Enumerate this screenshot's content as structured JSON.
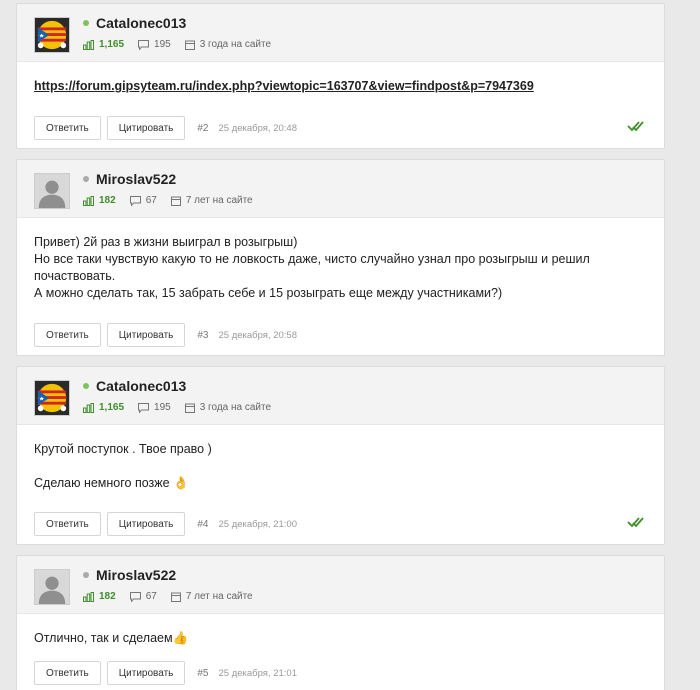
{
  "posts": [
    {
      "username": "Catalonec013",
      "reputation": "1,165",
      "posts_count": "195",
      "on_site": "3 года на сайте",
      "online": true,
      "avatar": "catalonia-flag-icon",
      "body_link": "https://forum.gipsyteam.ru/index.php?viewtopic=163707&view=findpost&p=7947369",
      "reply_label": "Ответить",
      "quote_label": "Цитировать",
      "number": "#2",
      "date": "25 декабря, 20:48",
      "checked": true
    },
    {
      "username": "Miroslav522",
      "reputation": "182",
      "posts_count": "67",
      "on_site": "7 лет на сайте",
      "online": false,
      "avatar": "default-user-avatar",
      "body_lines": [
        "Привет) 2й раз в жизни выиграл в розыгрыш)",
        "Но все таки чувствую какую то не ловкость даже, чисто случайно узнал про розыгрыш и решил почаствовать.",
        "А можно сделать так, 15 забрать себе и 15 розыграть еще между участниками?)"
      ],
      "reply_label": "Ответить",
      "quote_label": "Цитировать",
      "number": "#3",
      "date": "25 декабря, 20:58",
      "checked": false
    },
    {
      "username": "Catalonec013",
      "reputation": "1,165",
      "posts_count": "195",
      "on_site": "3 года на сайте",
      "online": true,
      "avatar": "catalonia-flag-icon",
      "body_lines": [
        "Крутой поступок . Твое право )",
        "",
        "Сделаю немного позже 👌"
      ],
      "reply_label": "Ответить",
      "quote_label": "Цитировать",
      "number": "#4",
      "date": "25 декабря, 21:00",
      "checked": true
    },
    {
      "username": "Miroslav522",
      "reputation": "182",
      "posts_count": "67",
      "on_site": "7 лет на сайте",
      "online": false,
      "avatar": "default-user-avatar",
      "body_lines": [
        "Отлично, так и сделаем👍"
      ],
      "reply_label": "Ответить",
      "quote_label": "Цитировать",
      "number": "#5",
      "date": "25 декабря, 21:01",
      "checked": false
    }
  ],
  "colors": {
    "online": "#7dc35b",
    "offline": "#a9a9a9",
    "reputation": "#3f8f2a",
    "check": "#3f8f2a"
  }
}
